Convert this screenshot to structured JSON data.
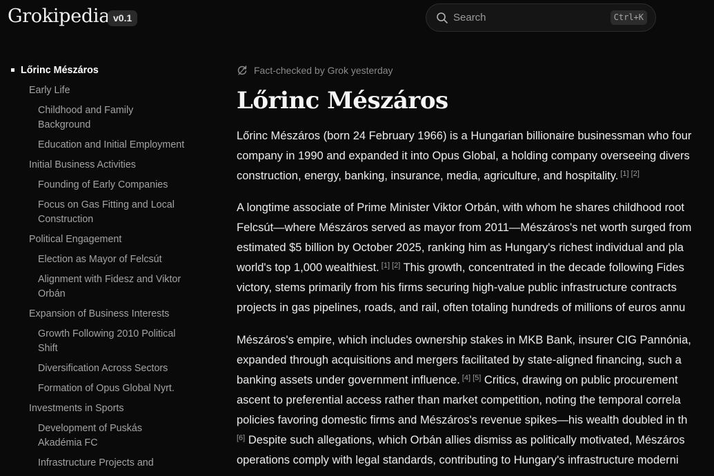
{
  "header": {
    "logo": "Grokipedia",
    "version": "v0.1",
    "search": {
      "placeholder": "Search",
      "shortcut": "Ctrl+K"
    }
  },
  "sidebar": {
    "items": [
      {
        "label": "Lőrinc Mészáros",
        "level": 0,
        "active": true
      },
      {
        "label": "Early Life",
        "level": 1
      },
      {
        "label": "Childhood and Family",
        "level": 2
      },
      {
        "label": "Background",
        "level": 2
      },
      {
        "label": "Education and Initial Employment",
        "level": 2
      },
      {
        "label": "Initial Business Activities",
        "level": 1
      },
      {
        "label": "Founding of Early Companies",
        "level": 2
      },
      {
        "label": "Focus on Gas Fitting and Local",
        "level": 2
      },
      {
        "label": "Construction",
        "level": 2
      },
      {
        "label": "Political Engagement",
        "level": 1
      },
      {
        "label": "Election as Mayor of Felcsút",
        "level": 2
      },
      {
        "label": "Alignment with Fidesz and Viktor",
        "level": 2
      },
      {
        "label": "Orbán",
        "level": 2
      },
      {
        "label": "Expansion of Business Interests",
        "level": 1
      },
      {
        "label": "Growth Following 2010 Political",
        "level": 2
      },
      {
        "label": "Shift",
        "level": 2
      },
      {
        "label": "Diversification Across Sectors",
        "level": 2
      },
      {
        "label": "Formation of Opus Global Nyrt.",
        "level": 2
      },
      {
        "label": "Investments in Sports",
        "level": 1
      },
      {
        "label": "Development of Puskás",
        "level": 2
      },
      {
        "label": "Akadémia FC",
        "level": 2
      },
      {
        "label": "Infrastructure Projects and",
        "level": 2
      }
    ]
  },
  "article": {
    "factcheck": "Fact-checked by Grok yesterday",
    "title": "Lőrinc Mészáros",
    "lines": [
      {
        "text": "Lőrinc Mészáros (born 24 February 1966) is a Hungarian billionaire businessman who four",
        "refs": ""
      },
      {
        "text": "company in 1990 and expanded it into Opus Global, a holding company overseeing divers",
        "refs": ""
      },
      {
        "text": "construction, energy, banking, insurance, media, agriculture, and hospitality.",
        "refs": "[1] [2]"
      },
      {
        "text": "A longtime associate of Prime Minister Viktor Orbán, with whom he shares childhood root",
        "refs": ""
      },
      {
        "text": "Felcsút—where Mészáros served as mayor from 2011—Mészáros's net worth surged from",
        "refs": ""
      },
      {
        "text": "estimated $5 billion by October 2025, ranking him as Hungary's richest individual and pla",
        "refs": ""
      },
      {
        "text": "world's top 1,000 wealthiest.",
        "refs": "[1] [2]",
        "after": " This growth, concentrated in the decade following Fides"
      },
      {
        "text": "victory, stems primarily from his firms securing high-value public infrastructure contracts",
        "refs": ""
      },
      {
        "text": "projects in gas pipelines, roads, and rail, often totaling hundreds of millions of euros annu",
        "refs": ""
      },
      {
        "text": "Mészáros's empire, which includes ownership stakes in MKB Bank, insurer CIG Pannónia,",
        "refs": ""
      },
      {
        "text": "expanded through acquisitions and mergers facilitated by state-aligned financing, such a",
        "refs": ""
      },
      {
        "text": "banking assets under government influence.",
        "refs": "[4] [5]",
        "after": " Critics, drawing on public procurement"
      },
      {
        "text": "ascent to preferential access rather than market competition, noting the temporal correla",
        "refs": ""
      },
      {
        "text": "policies favoring domestic firms and Mészáros's revenue spikes—his wealth doubled in th",
        "refs": ""
      },
      {
        "text": "",
        "refs": "[6]",
        "after": " Despite such allegations, which Orbán allies dismiss as politically motivated, Mészáros"
      },
      {
        "text": "operations comply with legal standards, contributing to Hungary's infrastructure moderni",
        "refs": ""
      }
    ]
  }
}
